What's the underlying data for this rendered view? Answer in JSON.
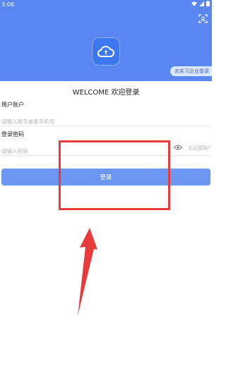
{
  "status_bar": {
    "time": "3:06",
    "icons": [
      "wifi-icon",
      "signal-icon",
      "battery-icon"
    ]
  },
  "header": {
    "background": "#5a86f2",
    "logo_icon": "cloud-icon",
    "scan_icon": "scan-icon",
    "enterprise_link": "去实习企业登录"
  },
  "welcome_title": "WELCOME 欢迎登录",
  "account": {
    "label": "用户账户",
    "placeholder": "请输入账号或者手机号"
  },
  "password": {
    "label": "登录密码",
    "placeholder": "请输入密码",
    "eye_icon": "eye-icon",
    "forgot": "忘记密码?"
  },
  "login_button": {
    "label": "登录",
    "color": "#6b97f3"
  },
  "annotation": {
    "color": "#e83b3b"
  }
}
